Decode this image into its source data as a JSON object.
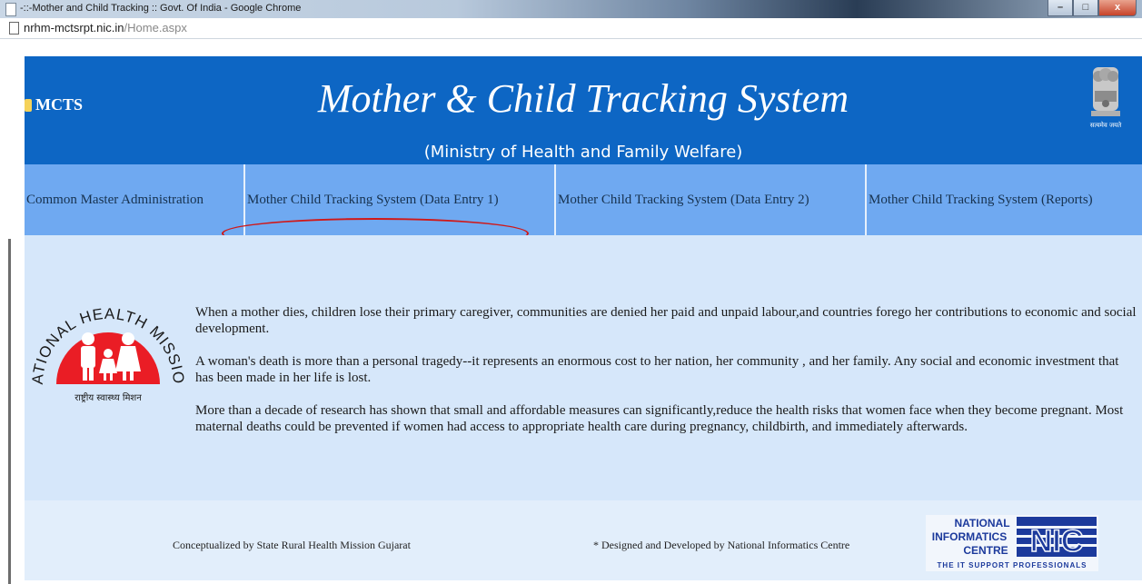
{
  "browser": {
    "window_title": "-::-Mother and Child Tracking :: Govt. Of India - Google Chrome",
    "url_domain": "nrhm-mctsrpt.nic.in",
    "url_path": "/Home.aspx",
    "minimize": "–",
    "maximize": "□",
    "close": "x"
  },
  "header": {
    "brand": "MCTS",
    "title": "Mother & Child Tracking System",
    "subtitle": "(Ministry of Health and Family Welfare)",
    "emblem_text": "सत्यमेव जयते"
  },
  "nav": {
    "items": [
      {
        "label": "Common Master Administration"
      },
      {
        "label": "Mother Child Tracking System (Data Entry 1)"
      },
      {
        "label": "Mother Child Tracking System (Data Entry 2)"
      },
      {
        "label": "Mother Child Tracking System (Reports)"
      }
    ]
  },
  "nhm_logo": {
    "top_text": "NATIONAL HEALTH MISSION",
    "bottom_text": "राष्ट्रीय स्वास्थ्य मिशन"
  },
  "content": {
    "paragraphs": [
      "When a mother dies, children lose their primary caregiver, communities are denied her paid and unpaid labour,and countries forego her contributions to economic and social development.",
      "A woman's death is more than a personal tragedy--it represents an enormous cost to her nation, her community , and her family. Any social and economic investment that has been made in her life is lost.",
      "More than a decade of research has shown that small and affordable measures can significantly,reduce the health risks that women face when they become pregnant. Most maternal deaths could be prevented if women had access to appropriate health care during pregnancy, childbirth, and immediately afterwards."
    ]
  },
  "footer": {
    "left_credit": "Conceptualized by State Rural Health Mission Gujarat",
    "mid_credit": "* Designed and Developed by National Informatics Centre",
    "nic_line1": "NATIONAL",
    "nic_line2": "INFORMATICS",
    "nic_line3": "CENTRE",
    "nic_mark": "NIC",
    "nic_tagline": "THE IT SUPPORT PROFESSIONALS"
  },
  "colors": {
    "header_blue": "#0d66c4",
    "nav_blue": "#6fa9f1",
    "content_bg": "#d6e7fa",
    "footer_bg": "#e2eefb",
    "highlight_red": "#d01818"
  }
}
